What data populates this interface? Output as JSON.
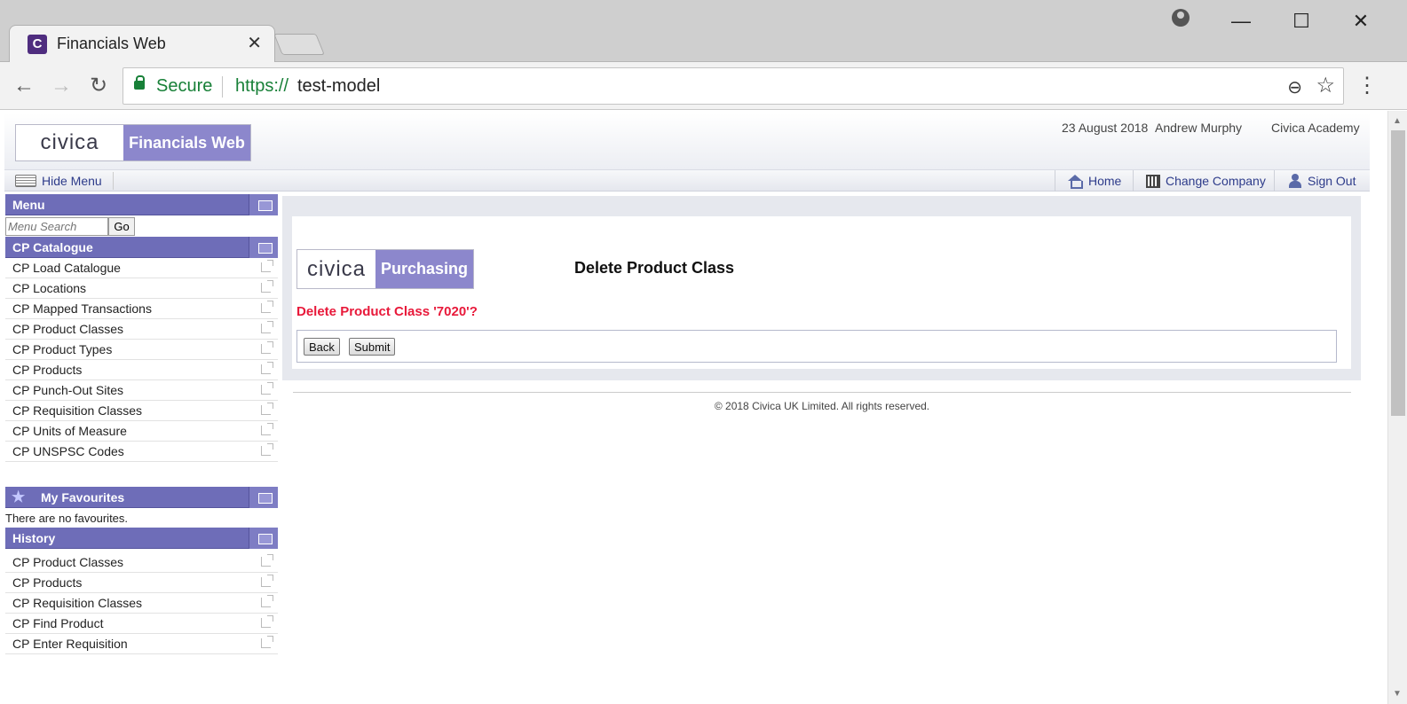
{
  "browser": {
    "tab_title": "Financials Web",
    "tab_favicon_letter": "C",
    "secure_label": "Secure",
    "url_scheme": "https://",
    "url_host": "test-model"
  },
  "header": {
    "logo_brand": "civica",
    "logo_product": "Financials Web",
    "date": "23 August 2018",
    "user": "Andrew Murphy",
    "company": "Civica Academy"
  },
  "toolbar": {
    "hide_menu": "Hide Menu",
    "home": "Home",
    "change_company": "Change Company",
    "sign_out": "Sign Out"
  },
  "sidebar": {
    "menu_title": "Menu",
    "search_placeholder": "Menu Search",
    "go_label": "Go",
    "catalogue_title": "CP Catalogue",
    "catalogue_items": [
      "CP Load Catalogue",
      "CP Locations",
      "CP Mapped Transactions",
      "CP Product Classes",
      "CP Product Types",
      "CP Products",
      "CP Punch-Out Sites",
      "CP Requisition Classes",
      "CP Units of Measure",
      "CP UNSPSC Codes"
    ],
    "favourites_title": "My Favourites",
    "no_favourites": "There are no favourites.",
    "history_title": "History",
    "history_items": [
      "CP Product Classes",
      "CP Products",
      "CP Requisition Classes",
      "CP Find Product",
      "CP Enter Requisition"
    ]
  },
  "main": {
    "logo_brand": "civica",
    "logo_product": "Purchasing",
    "page_title": "Delete Product Class",
    "confirm_message": "Delete Product Class '7020'?",
    "back_label": "Back",
    "submit_label": "Submit",
    "copyright": "© 2018 Civica UK Limited. All rights reserved."
  },
  "colors": {
    "brand_purple": "#8c87cc",
    "panel_header": "#6e6db8",
    "link_blue": "#2d3b8a",
    "alert_red": "#e8193a",
    "secure_green": "#188038"
  }
}
